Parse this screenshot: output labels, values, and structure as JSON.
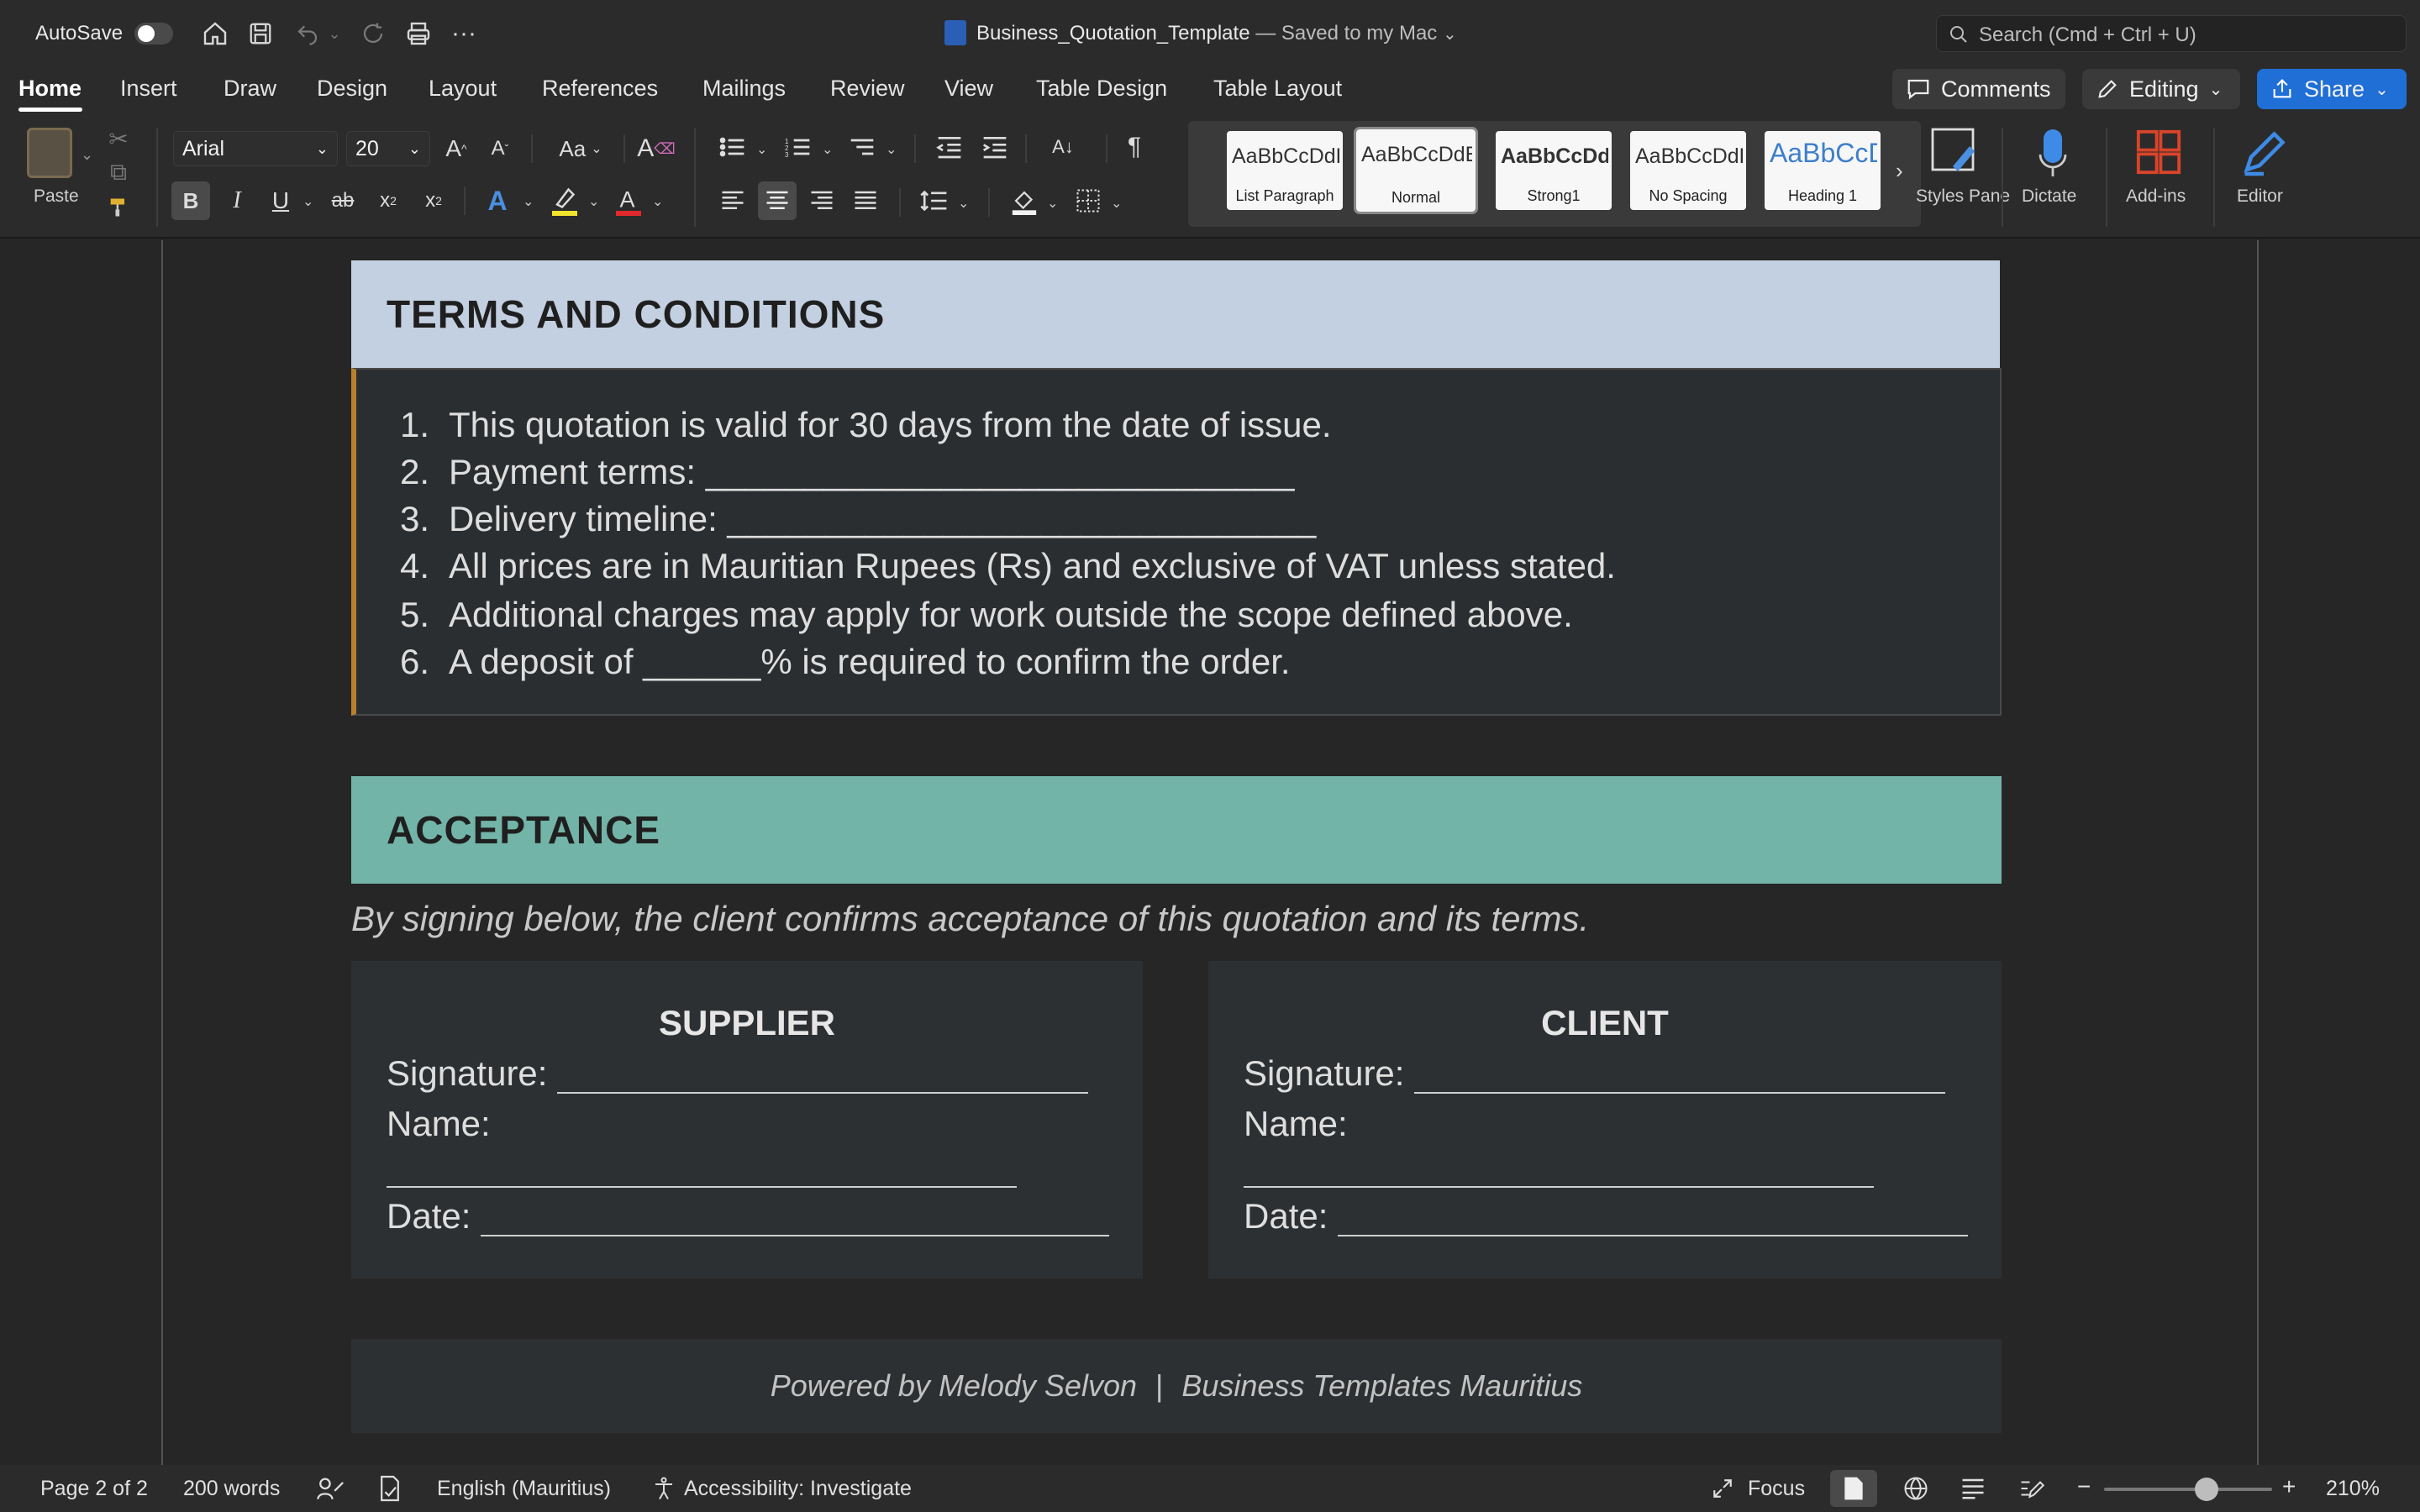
{
  "titlebar": {
    "autosave_label": "AutoSave",
    "doc_name": "Business_Quotation_Template",
    "save_state": "— Saved to my Mac",
    "search_placeholder": "Search (Cmd + Ctrl + U)"
  },
  "tabs": [
    "Home",
    "Insert",
    "Draw",
    "Design",
    "Layout",
    "References",
    "Mailings",
    "Review",
    "View",
    "Table Design",
    "Table Layout"
  ],
  "tab_actions": {
    "comments": "Comments",
    "editing": "Editing",
    "share": "Share"
  },
  "ribbon": {
    "paste_label": "Paste",
    "font_name": "Arial",
    "font_size": "20",
    "case_label": "Aa",
    "styles": [
      {
        "sample": "AaBbCcDdEe",
        "name": "List Paragraph"
      },
      {
        "sample": "AaBbCcDdEe",
        "name": "Normal"
      },
      {
        "sample": "AaBbCcDdE",
        "name": "Strong1"
      },
      {
        "sample": "AaBbCcDdEe",
        "name": "No Spacing"
      },
      {
        "sample": "AaBbCcDd",
        "name": "Heading 1"
      }
    ],
    "styles_pane": "Styles Pane",
    "dictate": "Dictate",
    "addins": "Add-ins",
    "editor": "Editor"
  },
  "document": {
    "terms_heading": "TERMS AND CONDITIONS",
    "terms": [
      {
        "num": "1.",
        "text": "This quotation is valid for 30 days from the date of issue."
      },
      {
        "num": "2.",
        "text": "Payment terms: ______________________________"
      },
      {
        "num": "3.",
        "text": "Delivery timeline: ______________________________"
      },
      {
        "num": "4.",
        "text": "All prices are in Mauritian Rupees (Rs) and exclusive of VAT unless stated."
      },
      {
        "num": "5.",
        "text": "Additional charges may apply for work outside the scope defined above."
      },
      {
        "num": "6.",
        "text": "A deposit of ______% is required to confirm the order."
      }
    ],
    "acceptance_heading": "ACCEPTANCE",
    "acceptance_note": "By signing below, the client confirms acceptance of this quotation and its terms.",
    "supplier": {
      "title": "SUPPLIER",
      "signature": "Signature: ",
      "name": "Name:",
      "date": "Date: "
    },
    "client": {
      "title": "CLIENT",
      "signature": "Signature: ",
      "name": "Name:",
      "date": "Date: "
    },
    "footer_left": "Powered by Melody Selvon",
    "footer_sep": "|",
    "footer_right": "Business Templates Mauritius"
  },
  "status": {
    "page": "Page 2 of 2",
    "words": "200 words",
    "language": "English (Mauritius)",
    "accessibility": "Accessibility: Investigate",
    "focus": "Focus",
    "zoom": "210%"
  },
  "colors": {
    "terms_header_bg": "#c3d0e1",
    "acceptance_header_bg": "#73b4a8",
    "terms_accent": "#b9802d",
    "share_blue": "#1f6fd6"
  }
}
